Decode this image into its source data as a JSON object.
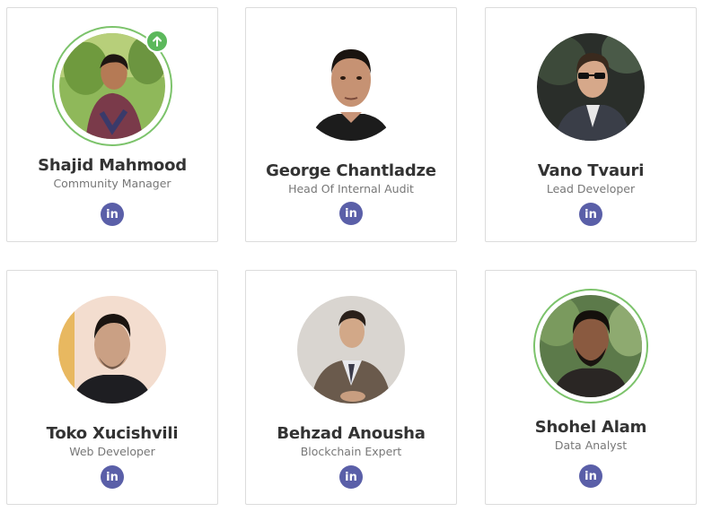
{
  "team": [
    {
      "name": "Shajid Mahmood",
      "role": "Community Manager",
      "social": "linkedin-icon",
      "social_glyph": "in",
      "highlighted": true,
      "badge": "arrow-up-icon"
    },
    {
      "name": "George Chantladze",
      "role": "Head Of Internal Audit",
      "social": "linkedin-icon",
      "social_glyph": "in",
      "highlighted": false
    },
    {
      "name": "Vano Tvauri",
      "role": "Lead Developer",
      "social": "linkedin-icon",
      "social_glyph": "in",
      "highlighted": false
    },
    {
      "name": "Toko Xucishvili",
      "role": "Web Developer",
      "social": "linkedin-icon",
      "social_glyph": "in",
      "highlighted": false
    },
    {
      "name": "Behzad Anousha",
      "role": "Blockchain Expert",
      "social": "linkedin-icon",
      "social_glyph": "in",
      "highlighted": false
    },
    {
      "name": "Shohel Alam",
      "role": "Data Analyst",
      "social": "linkedin-icon",
      "social_glyph": "in",
      "highlighted": true
    }
  ],
  "colors": {
    "highlight_ring": "#7cc36b",
    "badge": "#5cb85c",
    "social": "#5a5fa8",
    "name": "#333333",
    "role": "#777777"
  }
}
